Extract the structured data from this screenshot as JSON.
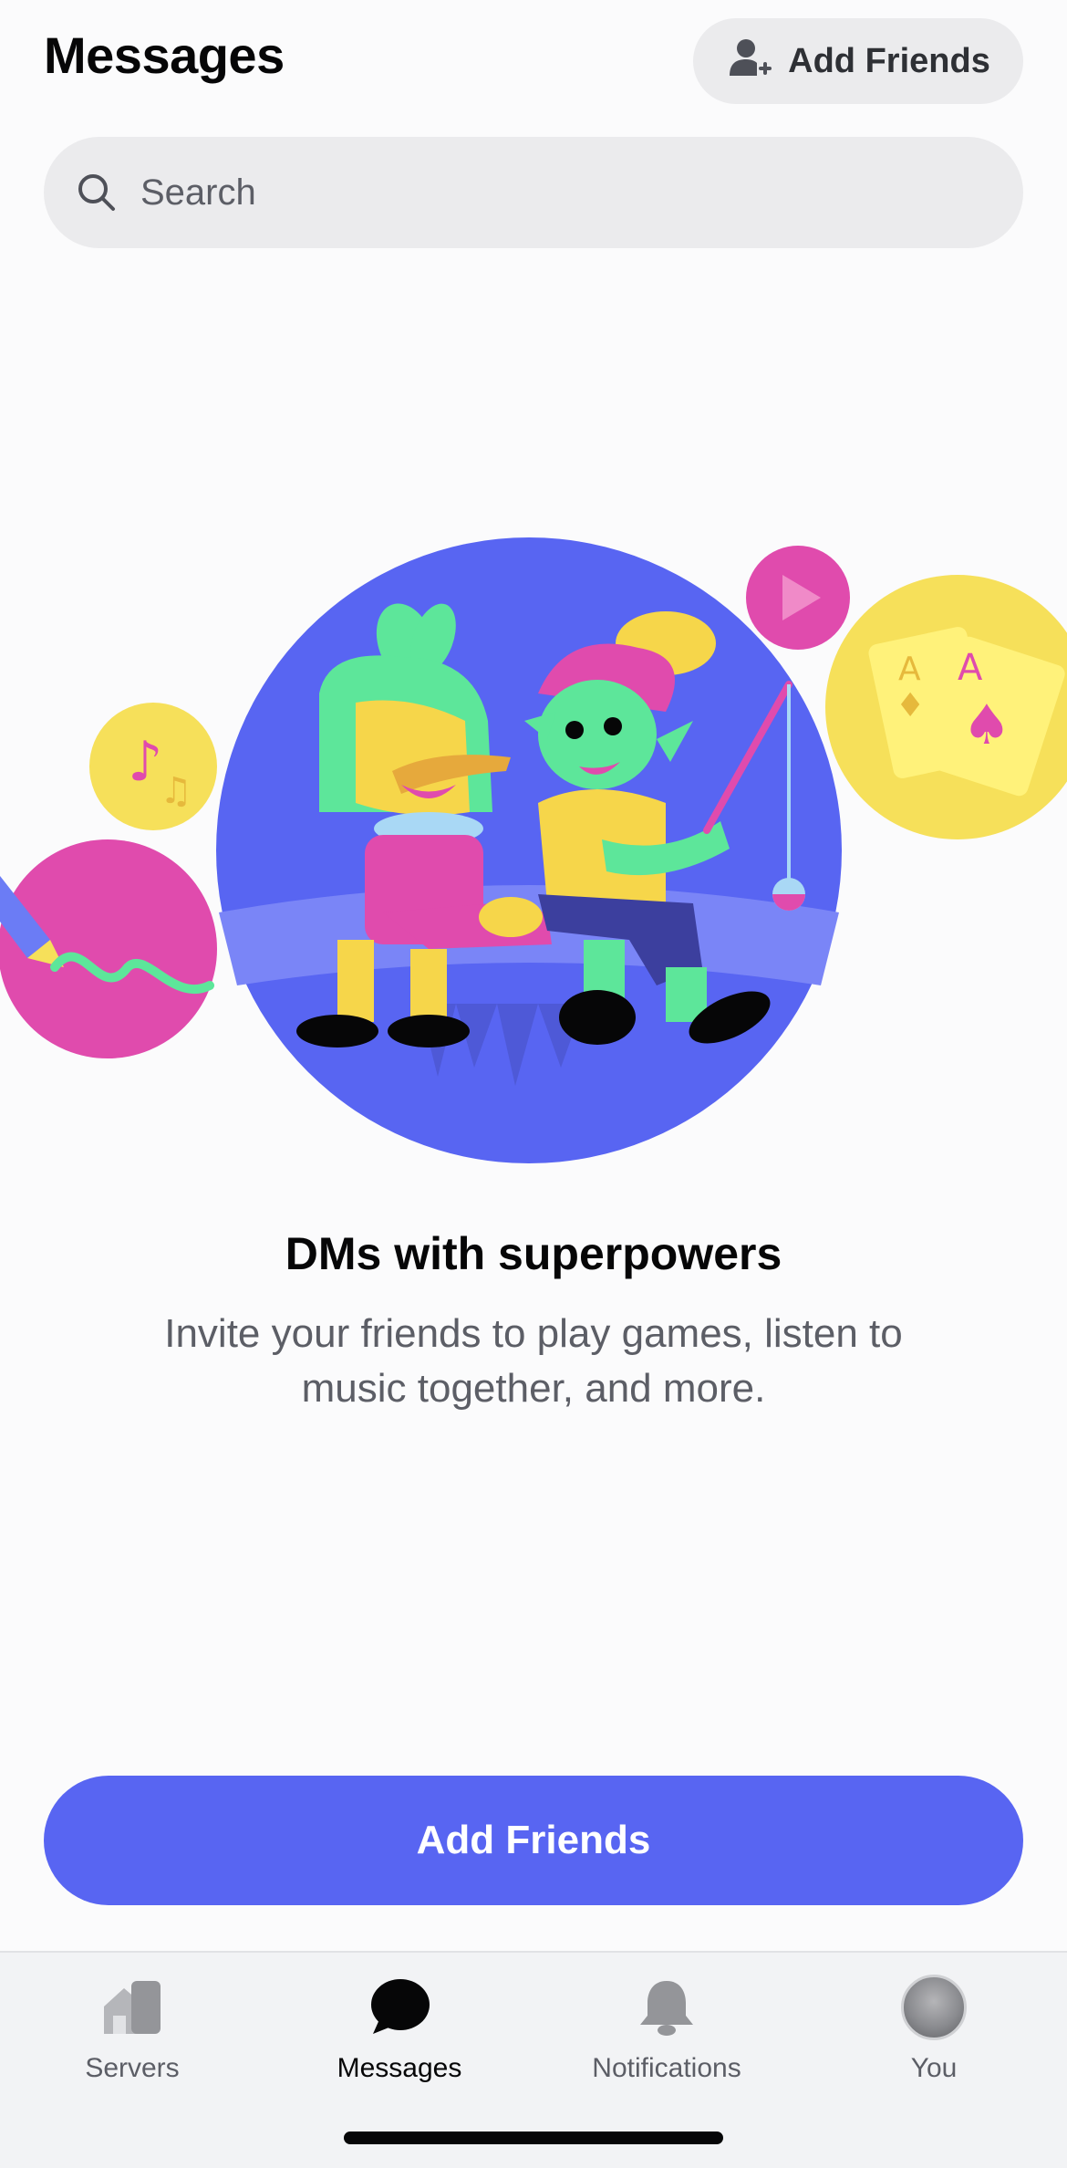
{
  "header": {
    "title": "Messages",
    "add_friends_label": "Add Friends"
  },
  "search": {
    "placeholder": "Search"
  },
  "empty_state": {
    "title": "DMs with superpowers",
    "description": "Invite your friends to play games, listen to music together, and more.",
    "cta_label": "Add Friends"
  },
  "tabs": [
    {
      "label": "Servers",
      "icon": "servers-icon",
      "active": false
    },
    {
      "label": "Messages",
      "icon": "chat-bubble-icon",
      "active": true
    },
    {
      "label": "Notifications",
      "icon": "bell-icon",
      "active": false
    },
    {
      "label": "You",
      "icon": "avatar",
      "active": false
    }
  ],
  "colors": {
    "brand": "#5865f2",
    "background": "#fbfbfc",
    "pill": "#ebebed"
  }
}
